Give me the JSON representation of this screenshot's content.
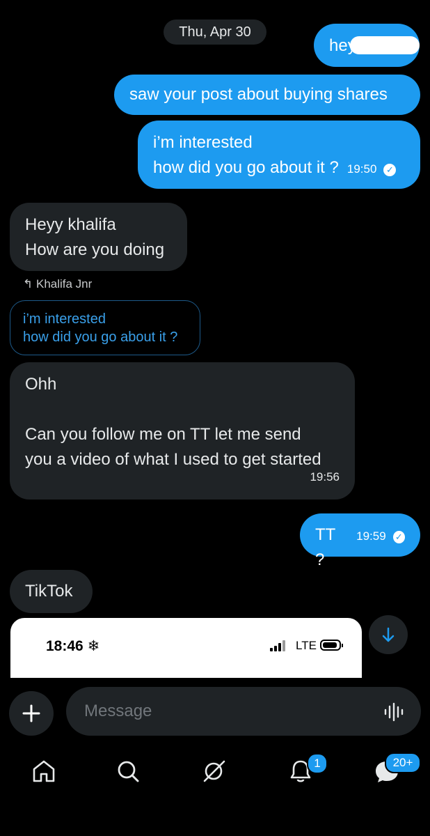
{
  "date_separator": "Thu, Apr 30",
  "messages": [
    {
      "dir": "out",
      "text": "hey",
      "redacted": true
    },
    {
      "dir": "out",
      "text": "saw your post about buying shares"
    },
    {
      "dir": "out",
      "line1": "i’m interested",
      "line2": "how did you go about it ?",
      "time": "19:50"
    },
    {
      "dir": "in",
      "line1": "Heyy khalifa",
      "line2": "How are you doing"
    },
    {
      "reply_to": "Khalifa Jnr",
      "quote_line1": "i’m interested",
      "quote_line2": "how did you go about it ?"
    },
    {
      "dir": "in",
      "line1": "Ohh",
      "line2": "Can you follow me on TT let me send",
      "line3": "you a video of what I used to get started",
      "time": "19:56"
    },
    {
      "dir": "out",
      "text": "TT ?",
      "time": "19:59"
    },
    {
      "dir": "in",
      "text": "TikTok"
    }
  ],
  "attachment_preview": {
    "clock": "18:46",
    "network": "LTE"
  },
  "composer": {
    "placeholder": "Message"
  },
  "nav": {
    "notifications_badge": "1",
    "messages_badge": "20+"
  },
  "colors": {
    "accent": "#1d9bf0",
    "bubble_incoming": "#1f2326",
    "background": "#000000"
  },
  "icons": [
    "home-icon",
    "search-icon",
    "grok-icon",
    "bell-icon",
    "messages-icon",
    "plus-icon",
    "voice-icon",
    "arrow-down-icon",
    "check-icon",
    "reply-arrow-icon",
    "snowflake-icon"
  ]
}
